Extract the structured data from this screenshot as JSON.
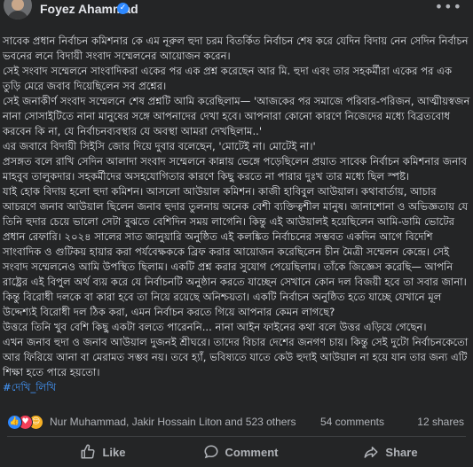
{
  "header": {
    "author_name": "Foyez Ahammad",
    "verified_icon": "verified-badge-icon",
    "more_icon": "more-options-icon"
  },
  "post": {
    "paragraphs": [
      "সাবেক প্রধান নির্বাচন কমিশনার কে এম নূরুল হুদা চরম বিতর্কিত নির্বাচন শেষ করে যেদিন বিদায় নেন সেদিন নির্বাচন ভবনের লনে বিদায়ী সংবাদ সম্মেলনের আয়োজন করেন।",
      "সেই সংবাদ সম্মেলনে সাংবাদিকরা একের পর এক প্রশ্ন করেছেন আর মি. হুদা এবং তার সহকর্মীরা একের পর এক তুড়ি মেরে জবাব দিয়েছিলেন সব প্রশ্নের।",
      "সেই জনাকীর্ণ সংবাদ সম্মেলনে শেষ প্রশ্নটি আমি করেছিলাম— 'আজকের পর সমাজে পরিবার-পরিজন, আত্মীয়স্বজন নানা সোসাইটিতে নানা মানুষের সঙ্গে আপনাদের দেখা হবে। আপনারা কোনো কারণে নিজেদের মধ্যে বিব্রতবোধ করবেন কি না, যে নির্বাচনব্যবস্থার যে অবস্থা আমরা দেখছিলাম..'",
      "এর জবাবে বিদায়ী সিইসি জোর দিয়ে দুবার বলেছেন, 'মোটেই না। মোটেই না।'",
      "প্রসঙ্গত বলে রাখি সেদিন আলাদা সংবাদ সম্মেলনে কান্নায় ভেঙ্গে পড়েছিলেন প্রয়াত সাবেক নির্বাচন কমিশনার জনাব মাহবুব তালুকদার। সহকর্মীদের অসহযোগিতার কারণে কিছু করতে না পারার দুঃখ তার মধ্যে ছিল স্পষ্ট।",
      "যাই হোক বিদায় হলো হুদা কমিশন। আসলো আউয়াল কমিশন। কাজী হাবিবুল আউয়াল। কথাবার্তায়, আচার আচরণে জনাব আউয়াল ছিলেন জনাব হুদার তুলনায় অনেক বেশী ব্যক্তিত্বশীল মানুষ। জানাশোনা ও অভিজ্ঞতায় যে তিনি হুদার চেয়ে ভালো সেটা বুঝতে বেশিদিন সময় লাগেনি। কিন্তু এই আউয়ালই হয়েছিলেন আমি-ডামি ভোটের প্রধান রেফারি। ২০২৪ সালের সাত জানুয়ারি অনুষ্ঠিত এই কলঙ্কিত নির্বাচনের সম্ভবত একদিন আগে বিদেশি সাংবাদিক ও গুটিকয় হায়ার করা পর্যবেক্ষককে ব্রিফ করার আয়োজন করেছিলেন চীন মৈত্রী সম্মেলন কেন্দ্রে। সেই সংবাদ সম্মেলনেও আমি উপস্থিত ছিলাম। একটি প্রশ্ন করার সুযোগ পেয়েছিলাম। তাঁকে জিজ্ঞেস করেছি— আপনি রাষ্ট্রের এই বিপুল অর্থ ব্যয় করে যে নির্বাচনটি অনুষ্ঠান করতে যাচ্ছেন সেখানে কোন দল বিজয়ী হবে তা সবার জানা। কিন্তু বিরোধী দলকে বা কারা হবে তা নিয়ে রয়েছে অনিশ্চয়তা। একটি নির্বাচন অনুষ্ঠিত হতে যাচ্ছে যেখানে মূল উদ্দেশ্যই বিরোধী দল ঠিক করা, এমন নির্বাচন করতে গিয়ে আপনার কেমন লাগছে?",
      "উত্তরে তিনি খুব বেশি কিছু একটা বলতে পারেননি... নানা আইন ফাইনের কথা বলে উত্তর এড়িয়ে গেছেন।",
      "এখন জনাব হুদা ও জনাব আউয়াল দুজনই শ্রীঘরে। তাদের বিচার দেশের জনগণ চায়। কিন্তু সেই দুটো নির্বাচনকেতো আর ফিরিয়ে আনা বা মেরামত সম্ভব নয়। তবে হ্যাঁ, ভবিষ্যতে যাতে কেউ হুদাই আউয়াল না হয়ে যান তার জন্য এটি শিক্ষা হতে পারে হয়তো।"
    ],
    "hashtag": "#দেখি_লিখি"
  },
  "stats": {
    "reactions_text": "Nur Muhammad, Jakir Hossain Liton and 523 others",
    "comments": "54 comments",
    "shares": "12 shares"
  },
  "actions": {
    "like": "Like",
    "comment": "Comment",
    "share": "Share"
  },
  "colors": {
    "background": "#242526",
    "text": "#e4e6eb",
    "muted": "#b0b3b8",
    "link": "#4599ff",
    "like_blue": "#2d88ff",
    "love_red": "#f33e58",
    "care_yellow": "#f7b125"
  }
}
